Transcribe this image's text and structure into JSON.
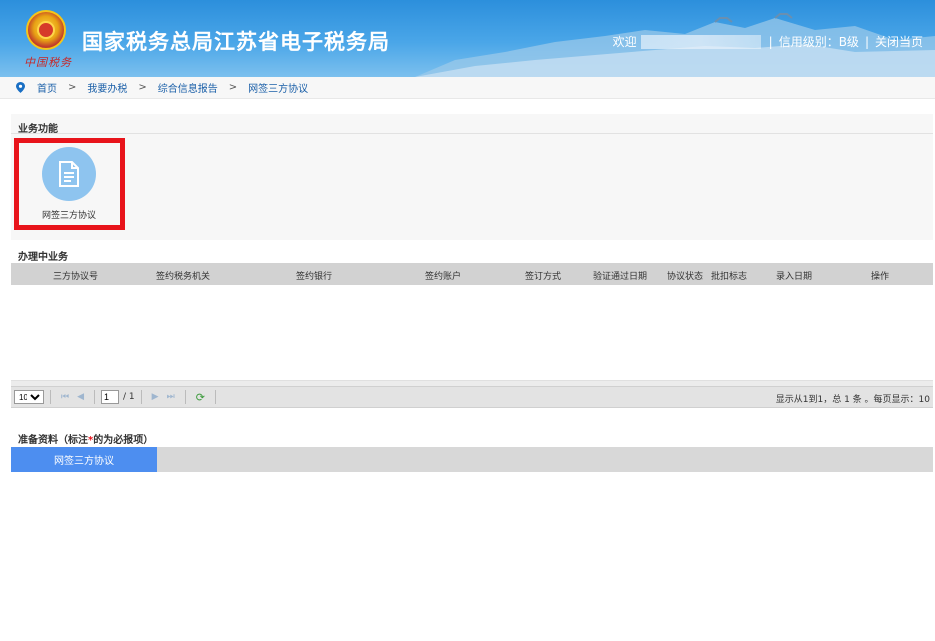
{
  "header": {
    "site_title": "国家税务总局江苏省电子税务局",
    "seal_text": "中国税务",
    "welcome": "欢迎",
    "credit_level": "信用级别：B级",
    "separator": "|",
    "close_page": "关闭当页"
  },
  "breadcrumb": {
    "items": [
      "首页",
      "我要办税",
      "综合信息报告",
      "网签三方协议"
    ],
    "arrow": ">"
  },
  "business_functions": {
    "title": "业务功能",
    "tiles": [
      {
        "label": "网签三方协议",
        "icon": "document-icon"
      }
    ]
  },
  "in_progress": {
    "title": "办理中业务",
    "columns": [
      "三方协议号",
      "签约税务机关",
      "签约银行",
      "签约账户",
      "签订方式",
      "验证通过日期",
      "协议状态",
      "批扣标志",
      "录入日期",
      "操作"
    ]
  },
  "pager": {
    "page_size": "10",
    "current_page": "1",
    "total_pages": "/ 1",
    "info": "显示从1到1，总 1 条 。每页显示：10"
  },
  "prep_materials": {
    "title_prefix": "准备资料（标注",
    "required_mark": "*",
    "title_suffix": "的为必报项）",
    "tabs": [
      "网签三方协议"
    ]
  },
  "colors": {
    "header_blue": "#2c8fdc",
    "highlight_red": "#e8141b",
    "tab_blue": "#4d8ef0",
    "link_blue": "#1a5fa8"
  }
}
